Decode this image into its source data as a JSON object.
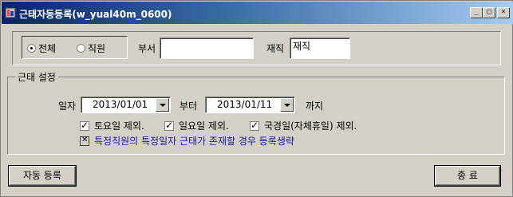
{
  "window": {
    "title": "근태자동등록(w_yual40m_0600)",
    "buttons": {
      "minimize": "_",
      "maximize": "□",
      "close": "×"
    }
  },
  "filter": {
    "radio_options": [
      {
        "label": "전체",
        "selected": true
      },
      {
        "label": "직원",
        "selected": false
      }
    ],
    "dept_label": "부서",
    "dept_value": "",
    "status_label": "재직",
    "status_value": "재직"
  },
  "settings": {
    "group_title": "근태 설정",
    "date_label": "일자",
    "date_from": "2013/01/01",
    "from_label": "부터",
    "date_to": "2013/01/11",
    "to_label": "까지",
    "checks": [
      {
        "label": "토요일 제외.",
        "checked": true
      },
      {
        "label": "일요일 제외.",
        "checked": true
      },
      {
        "label": "국경일(자체휴일) 제외.",
        "checked": true
      }
    ],
    "skip_existing_label": "특정직원의 특정일자 근태가 존재할 경우 등록생략"
  },
  "actions": {
    "auto_register": "자동 등록",
    "close": "종 료"
  }
}
